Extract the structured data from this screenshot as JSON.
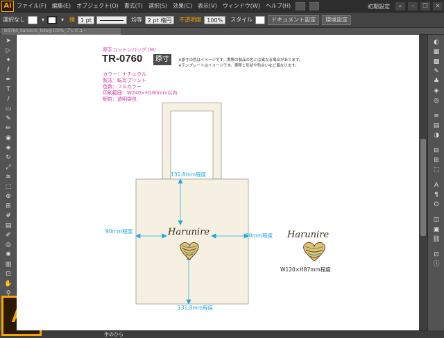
{
  "app": {
    "logo": "Ai",
    "big_logo": "Ai"
  },
  "menu": [
    "ファイル(F)",
    "編集(E)",
    "オブジェクト(O)",
    "書式(T)",
    "選択(S)",
    "効果(C)",
    "表示(V)",
    "ウィンドウ(W)",
    "ヘルプ(H)"
  ],
  "workspace": "初期設定",
  "control": {
    "selection": "選択なし",
    "stroke_label": "線",
    "stroke_weight": "1 pt",
    "stroke_style": "均等",
    "brush": "2 pt 楕円",
    "opacity_label": "不透明度",
    "opacity_value": "100%",
    "style_label": "スタイル",
    "doc_settings": "ドキュメント設定",
    "prefs": "環境設定"
  },
  "tab": {
    "title": "tr0760_harunire_tote@100%_プレビュー"
  },
  "status": {
    "tool_name": "手のひら"
  },
  "doc": {
    "subtitle": "厚手コットンバッグ (M)",
    "product_code": "TR-0760",
    "size_badge": "原寸",
    "notes": [
      "※原寸の色はイメージです。実際の製品の色とは異なる場合があります。",
      "※テンプレートはイメージです。実際と形状や色合いなど異なります。"
    ],
    "specs": [
      "カラー：ナチュラル",
      "製法：転写プリント",
      "色数：フルカラー",
      "印刷範囲：W240×H180mm以内",
      "梱包：透明袋包"
    ],
    "dims": {
      "top": "131.8mm程度",
      "bottom": "131.8mm程度",
      "left": "90mm程度",
      "right": "90mm程度"
    },
    "logo_text": "Harunire",
    "sample_size": "W120×H87mm程度"
  },
  "colors": {
    "accent": "#f7a400",
    "bag": "#f5f0e1",
    "dim_line": "#1ea8d8",
    "spec_text": "#d03aa8"
  }
}
